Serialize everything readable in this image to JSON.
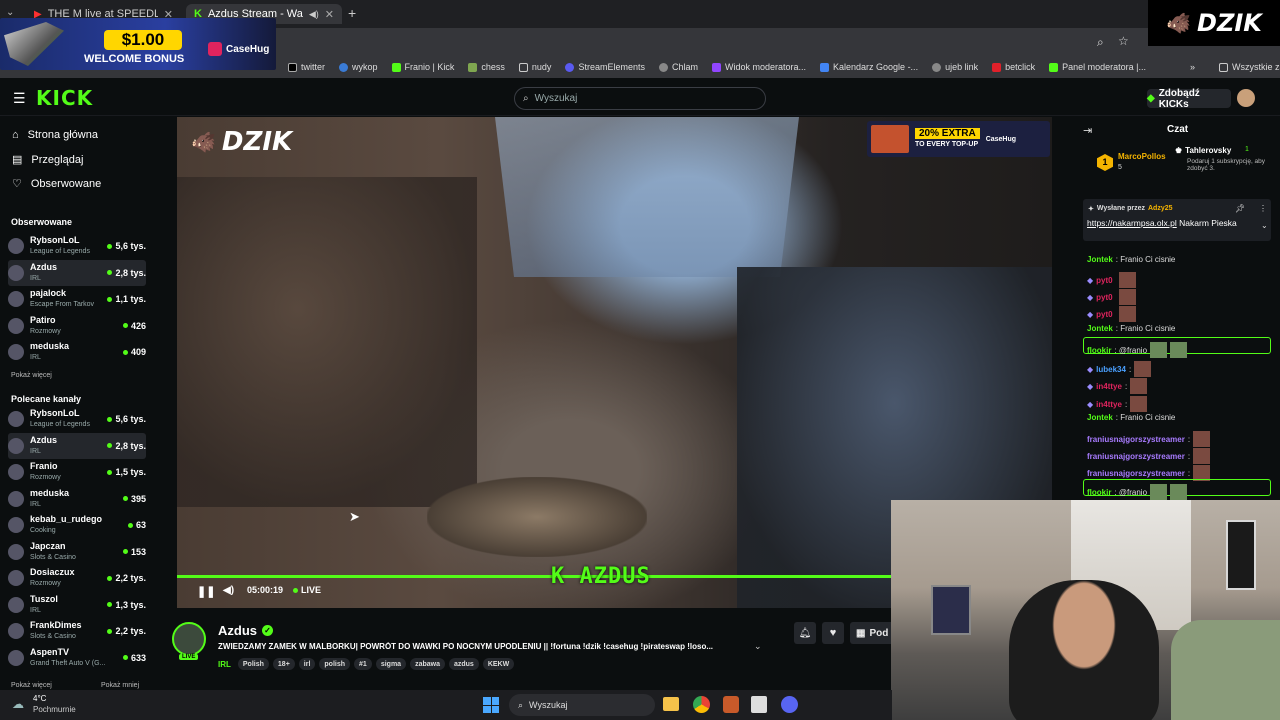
{
  "browser": {
    "tabs": [
      {
        "title": "THE M live at SPEEDLAND FEST",
        "close": "✕"
      },
      {
        "title": "Azdus Stream - Watch Live",
        "close": "✕"
      }
    ],
    "new_tab": "+",
    "bookmarks": [
      "twitter",
      "wykop",
      "Franio | Kick",
      "chess",
      "nudy",
      "StreamElements",
      "Chlam",
      "Widok moderatora...",
      "Kalendarz Google -...",
      "ujeb link",
      "betclick",
      "Panel moderatora |..."
    ],
    "all_bookmarks": "Wszystkie zakładki"
  },
  "ad": {
    "amount": "$1.00",
    "line": "WELCOME BONUS",
    "brand": "CaseHug"
  },
  "kick": {
    "logo": "KICK",
    "search_placeholder": "Wyszukaj",
    "kicks_button": "Zdobądź KICKs"
  },
  "sidebar": {
    "nav": [
      {
        "label": "Strona główna",
        "icon": "⌂"
      },
      {
        "label": "Przeglądaj",
        "icon": "▤"
      },
      {
        "label": "Obserwowane",
        "icon": "♡"
      }
    ],
    "followed_title": "Obserwowane",
    "followed": [
      {
        "name": "RybsonLoL",
        "cat": "League of Legends",
        "viewers": "5,6 tys."
      },
      {
        "name": "Azdus",
        "cat": "IRL",
        "viewers": "2,8 tys."
      },
      {
        "name": "pajalock",
        "cat": "Escape From Tarkov",
        "viewers": "1,1 tys."
      },
      {
        "name": "Patiro",
        "cat": "Rozmowy",
        "viewers": "426"
      },
      {
        "name": "meduska",
        "cat": "IRL",
        "viewers": "409"
      }
    ],
    "show_more": "Pokaż więcej",
    "recommended_title": "Polecane kanały",
    "recommended": [
      {
        "name": "RybsonLoL",
        "cat": "League of Legends",
        "viewers": "5,6 tys."
      },
      {
        "name": "Azdus",
        "cat": "IRL",
        "viewers": "2,8 tys."
      },
      {
        "name": "Franio",
        "cat": "Rozmowy",
        "viewers": "1,5 tys."
      },
      {
        "name": "meduska",
        "cat": "IRL",
        "viewers": "395"
      },
      {
        "name": "kebab_u_rudego",
        "cat": "Cooking",
        "viewers": "63"
      },
      {
        "name": "Japczan",
        "cat": "Slots & Casino",
        "viewers": "153"
      },
      {
        "name": "Dosiaczux",
        "cat": "Rozmowy",
        "viewers": "2,2 tys."
      },
      {
        "name": "Tuszol",
        "cat": "IRL",
        "viewers": "1,3 tys."
      },
      {
        "name": "FrankDimes",
        "cat": "Slots & Casino",
        "viewers": "2,2 tys."
      },
      {
        "name": "AspenTV",
        "cat": "Grand Theft Auto V (G...",
        "viewers": "633"
      }
    ],
    "show_more2": "Pokaż więcej",
    "show_less": "Pokaż mniej"
  },
  "video": {
    "watermark": "DZIK",
    "promo_top": "20% EXTRA",
    "promo_bottom": "TO EVERY TOP-UP",
    "promo_brand": "CaseHug",
    "overlay": "K AZDUS",
    "time": "05:00:19",
    "live": "LIVE"
  },
  "stream": {
    "streamer": "Azdus",
    "live_badge": "LIVE",
    "title": "ZWIEDZAMY ZAMEK W MALBORKU| POWRÓT DO WAWKI PO NOCNYM UPODLENIU || !fortuna !dzik !casehug !pirateswap !loso...",
    "category": "IRL",
    "tags": [
      "Polish",
      "18+",
      "irl",
      "polish",
      "#1",
      "sigma",
      "zabawa",
      "azdus",
      "KEKW"
    ],
    "share_partial": "Pod"
  },
  "chat": {
    "title": "Czat",
    "top_gifter": {
      "name": "MarcoPollos",
      "count": "5"
    },
    "sub_gifter": {
      "name": "Tahlerovsky",
      "count": "1",
      "note": "Podaruj 1 subskrypcję, aby zdobyć 3."
    },
    "pinned_label": "Wysłane przez",
    "pinned_by": "Adzy25",
    "pinned_link": "https://nakarmpsa.olx.pl",
    "pinned_text": "Nakarm Pieska",
    "messages": [
      {
        "user": "Jontek",
        "text": ": Franio Ci cisnie",
        "color": "#53fc18"
      },
      {
        "user": "pyt0",
        "text": "",
        "color": "#e0245e"
      },
      {
        "user": "pyt0",
        "text": "",
        "color": "#e0245e"
      },
      {
        "user": "pyt0",
        "text": "",
        "color": "#e0245e"
      },
      {
        "user": "Jontek",
        "text": ": Franio Ci cisnie",
        "color": "#53fc18"
      },
      {
        "user": "flookir",
        "text": ": @franio",
        "color": "#53fc18"
      },
      {
        "user": "lubek34",
        "text": ":",
        "color": "#4aa0ff"
      },
      {
        "user": "in4ttye",
        "text": ":",
        "color": "#e0245e"
      },
      {
        "user": "in4ttye",
        "text": ":",
        "color": "#e0245e"
      },
      {
        "user": "Jontek",
        "text": ": Franio Ci cisnie",
        "color": "#53fc18"
      },
      {
        "user": "franiusnajgorszystreamer",
        "text": ":",
        "color": "#a87bff"
      },
      {
        "user": "franiusnajgorszystreamer",
        "text": ":",
        "color": "#a87bff"
      },
      {
        "user": "franiusnajgorszystreamer",
        "text": ":",
        "color": "#a87bff"
      },
      {
        "user": "flookir",
        "text": ": @franio",
        "color": "#53fc18"
      }
    ]
  },
  "dzik_corner": "DZIK",
  "taskbar": {
    "temp": "4°C",
    "weather": "Pochmurnie",
    "search": "Wyszukaj"
  },
  "colors": {
    "kick_green": "#53fc18",
    "bg": "#0b0e0f"
  }
}
